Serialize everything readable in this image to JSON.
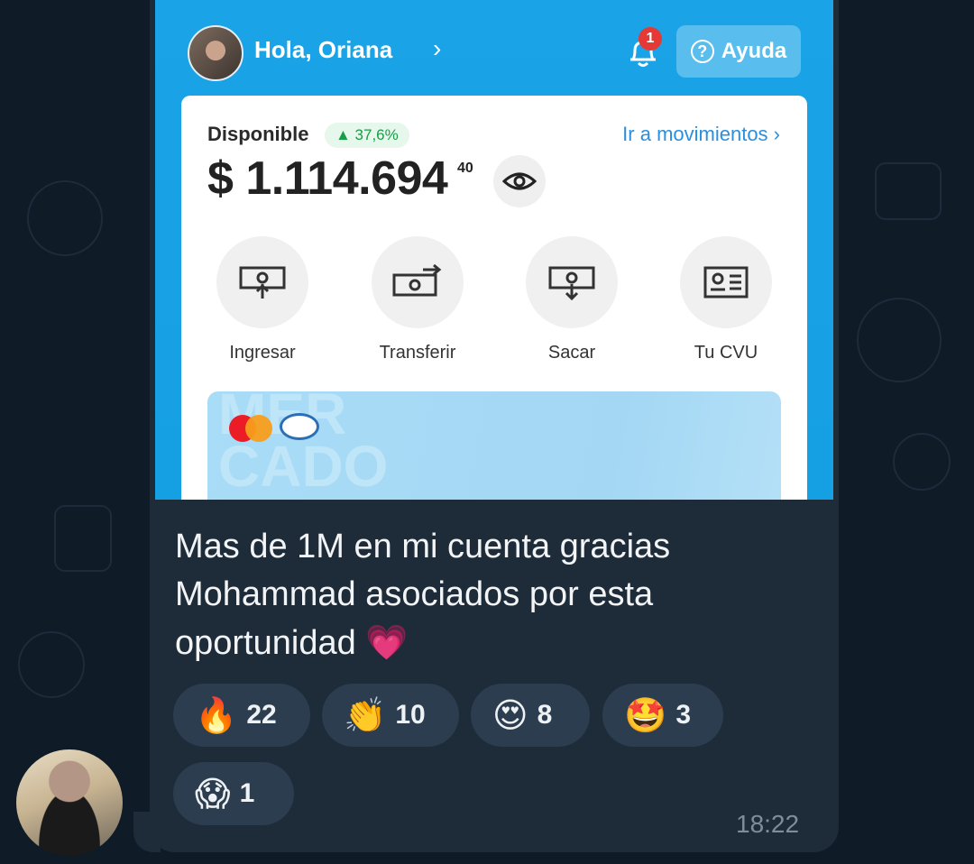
{
  "chat": {
    "message_text": "Mas de 1M en mi cuenta gracias Mohammad  asociados por esta oportunidad",
    "heart_emoji": "💗",
    "timestamp": "18:22",
    "reactions": [
      {
        "emoji": "🔥",
        "count": "22"
      },
      {
        "emoji": "👏",
        "count": "10"
      },
      {
        "emoji": "😍",
        "count": "8"
      },
      {
        "emoji": "🤩",
        "count": "3"
      },
      {
        "emoji": "😱",
        "count": "1"
      }
    ]
  },
  "screenshot": {
    "greeting": "Hola, Oriana",
    "greeting_chevron": "›",
    "notification_count": "1",
    "help_label": "Ayuda",
    "help_icon_glyph": "?",
    "available_label": "Disponible",
    "change_pct": "▲ 37,6%",
    "movements_link": "Ir a movimientos  ›",
    "balance": "$ 1.114.694",
    "balance_cents": "40",
    "actions": [
      {
        "label": "Ingresar",
        "icon": "deposit-icon"
      },
      {
        "label": "Transferir",
        "icon": "transfer-icon"
      },
      {
        "label": "Sacar",
        "icon": "withdraw-icon"
      },
      {
        "label": "Tu CVU",
        "icon": "id-card-icon"
      }
    ],
    "card_watermark": "MER\nCADO",
    "colors": {
      "brand_blue": "#16a0e4",
      "link_blue": "#2a8fde",
      "positive_green": "#1a9d48"
    }
  }
}
